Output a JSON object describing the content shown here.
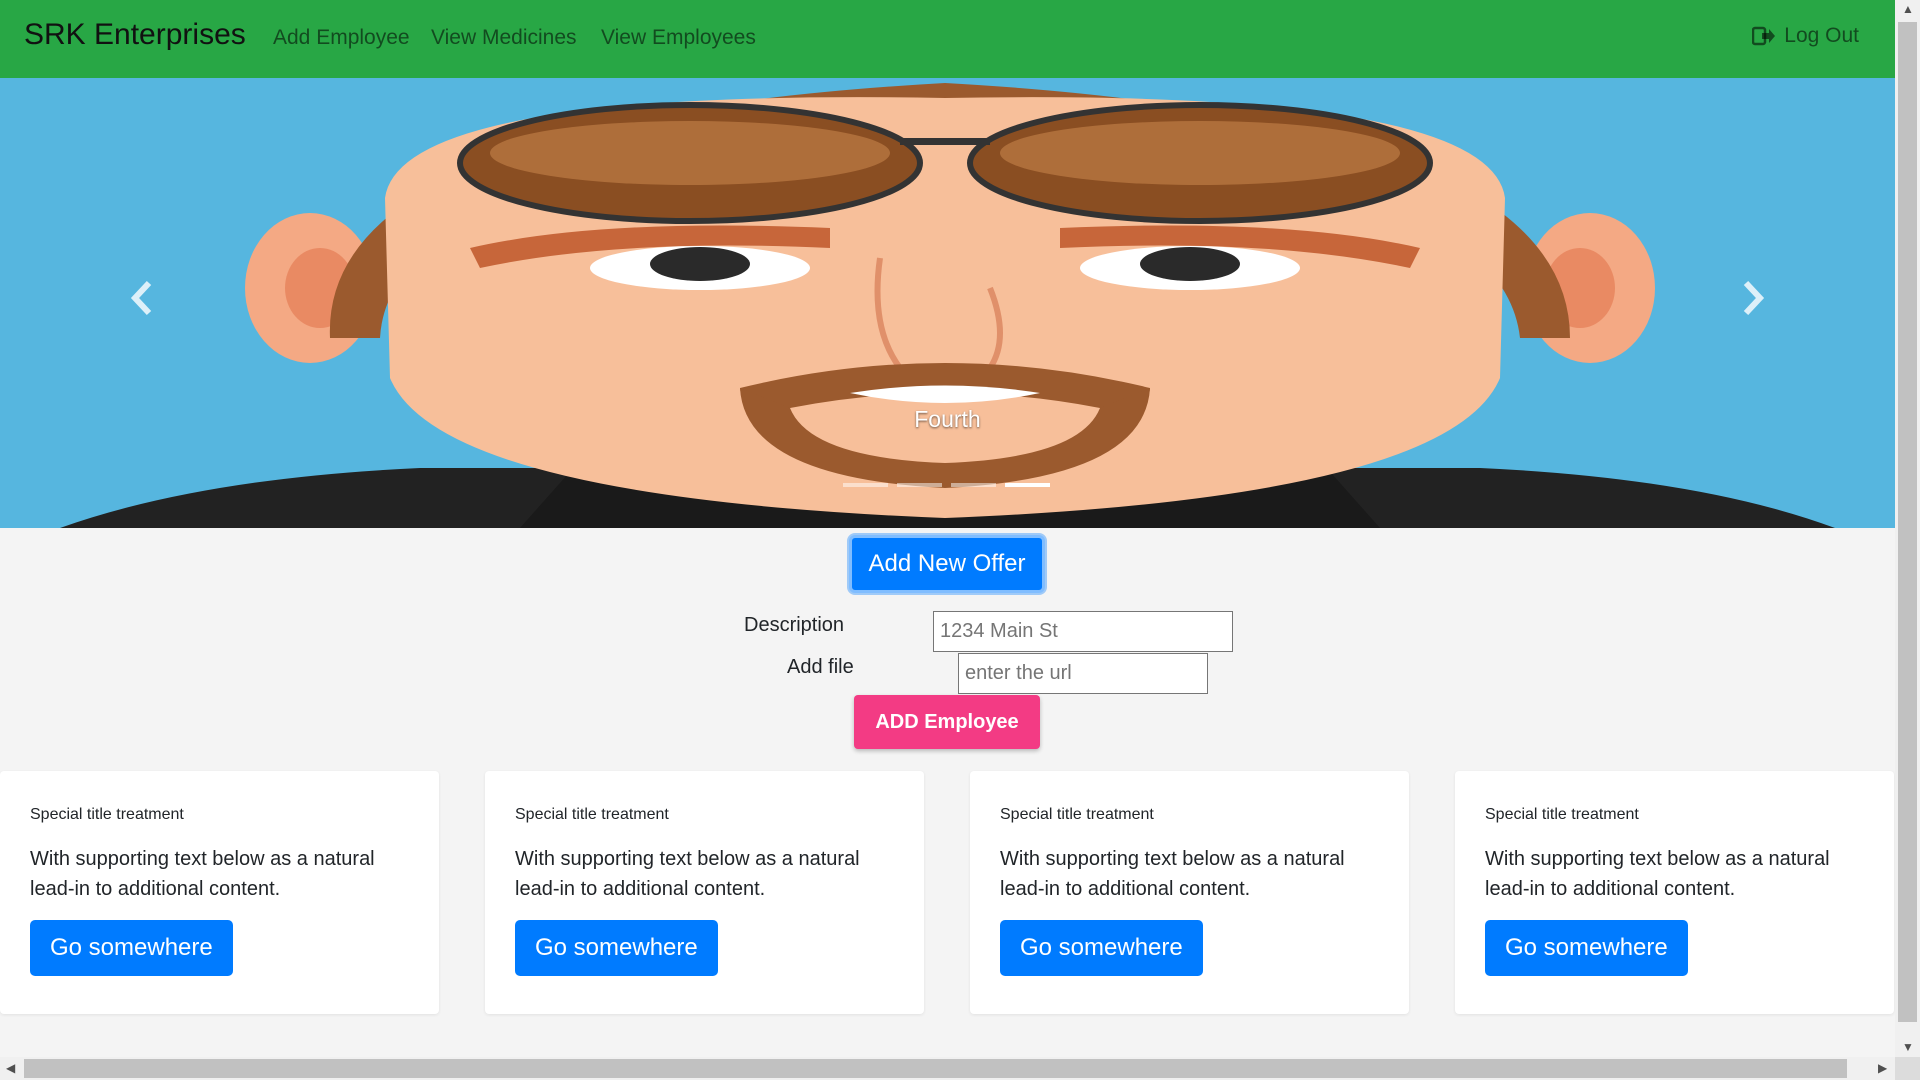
{
  "navbar": {
    "brand": "SRK Enterprises",
    "links": [
      "Add Employee",
      "View Medicines",
      "View Employees"
    ],
    "logout_label": "Log Out",
    "background": "#28a745"
  },
  "carousel": {
    "caption": "Fourth",
    "prev_icon": "chevron-left-icon",
    "next_icon": "chevron-right-icon",
    "slide_count": 4,
    "active_slide": 4
  },
  "form": {
    "offer_button": "Add New Offer",
    "description_label": "Description",
    "description_placeholder": "1234 Main St",
    "file_label": "Add file",
    "file_placeholder": "enter the url",
    "submit_button": "ADD Employee"
  },
  "cards": [
    {
      "title": "Special title treatment",
      "text": "With supporting text below as a natural lead-in to additional content.",
      "button": "Go somewhere"
    },
    {
      "title": "Special title treatment",
      "text": "With supporting text below as a natural lead-in to additional content.",
      "button": "Go somewhere"
    },
    {
      "title": "Special title treatment",
      "text": "With supporting text below as a natural lead-in to additional content.",
      "button": "Go somewhere"
    },
    {
      "title": "Special title treatment",
      "text": "With supporting text below as a natural lead-in to additional content.",
      "button": "Go somewhere"
    }
  ],
  "colors": {
    "primary": "#007bff",
    "accent": "#f33b84",
    "sky": "#56b6df"
  }
}
